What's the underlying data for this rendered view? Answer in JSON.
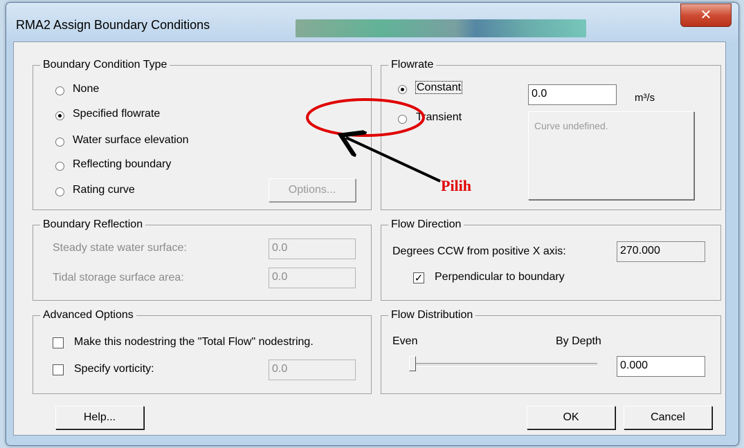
{
  "window": {
    "title": "RMA2 Assign Boundary Conditions",
    "close_symbol": "✕"
  },
  "bc_type": {
    "title": "Boundary Condition Type",
    "options": [
      {
        "label": "None",
        "selected": false
      },
      {
        "label": "Specified flowrate",
        "selected": true
      },
      {
        "label": "Water surface elevation",
        "selected": false
      },
      {
        "label": "Reflecting boundary",
        "selected": false
      },
      {
        "label": "Rating curve",
        "selected": false
      }
    ],
    "options_button": "Options..."
  },
  "flowrate": {
    "title": "Flowrate",
    "constant_label": "Constant",
    "transient_label": "Transient",
    "constant_selected": true,
    "value": "0.0",
    "unit": "m³/s",
    "curve_text": "Curve undefined."
  },
  "boundary_reflection": {
    "title": "Boundary Reflection",
    "steady_label": "Steady state water surface:",
    "steady_value": "0.0",
    "tidal_label": "Tidal storage surface area:",
    "tidal_value": "0.0"
  },
  "flow_direction": {
    "title": "Flow Direction",
    "degrees_label": "Degrees CCW from positive X axis:",
    "degrees_value": "270.000",
    "perpendicular_label": "Perpendicular to boundary",
    "perpendicular_checked": true
  },
  "advanced": {
    "title": "Advanced Options",
    "total_flow_label": "Make this nodestring the \"Total Flow\" nodestring.",
    "total_flow_checked": false,
    "vorticity_label": "Specify vorticity:",
    "vorticity_checked": false,
    "vorticity_value": "0.0"
  },
  "flow_distribution": {
    "title": "Flow Distribution",
    "even_label": "Even",
    "depth_label": "By Depth",
    "value": "0.000",
    "slider_level": 0.0
  },
  "buttons": {
    "help": "Help...",
    "ok": "OK",
    "cancel": "Cancel"
  },
  "annotation": {
    "text": "Pilih",
    "color": "#e00000"
  },
  "colors": {
    "dialog_face": "#f0f0f0",
    "titlebar": "#bcd4ea",
    "close_button": "#cf4d33",
    "annotation": "#e00000"
  }
}
